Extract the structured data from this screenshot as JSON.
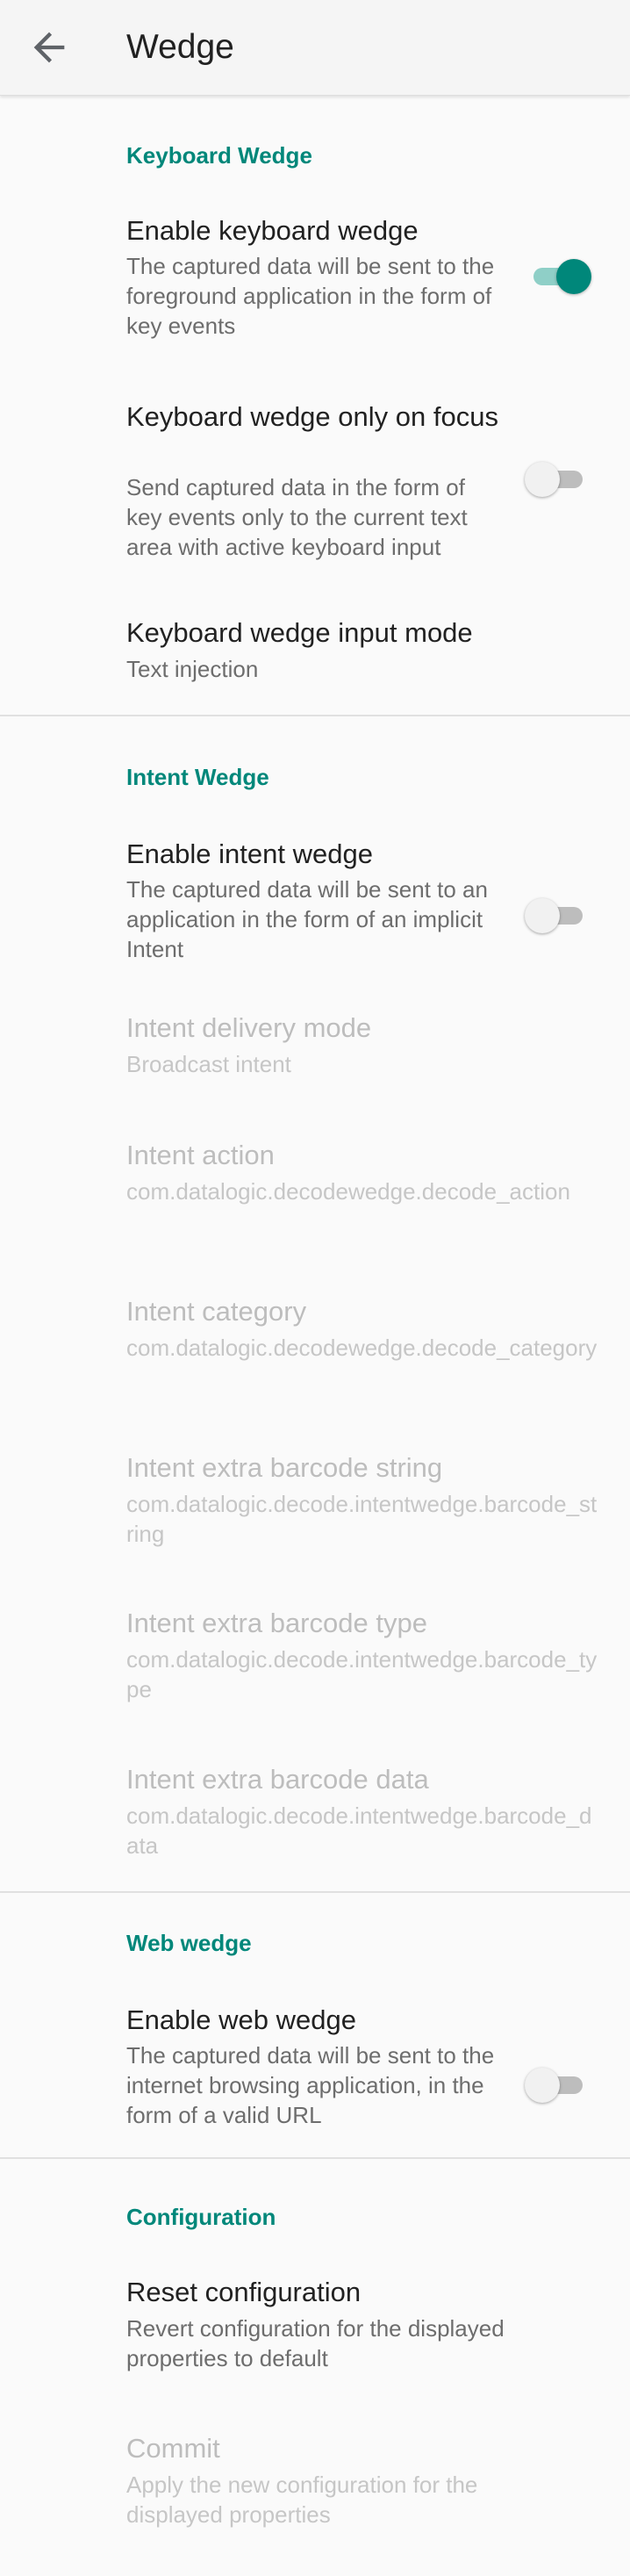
{
  "toolbar": {
    "title": "Wedge",
    "back_icon": "arrow-back-icon"
  },
  "keyboard_wedge": {
    "section_title": "Keyboard Wedge",
    "enable": {
      "title": "Enable keyboard wedge",
      "summary": "The captured data will be sent to the foreground application in the form of key events",
      "checked": true
    },
    "only_on_focus": {
      "title": "Keyboard wedge only on focus",
      "summary": "Send captured data in the form of key events only to the current text area with active keyboard input",
      "checked": false
    },
    "input_mode": {
      "title": "Keyboard wedge input mode",
      "summary": "Text injection"
    }
  },
  "intent_wedge": {
    "section_title": "Intent Wedge",
    "enable": {
      "title": "Enable intent wedge",
      "summary": "The captured data will be sent to an application in the form of an implicit Intent",
      "checked": false
    },
    "delivery_mode": {
      "title": "Intent delivery mode",
      "summary": "Broadcast intent"
    },
    "action": {
      "title": "Intent action",
      "summary": "com.datalogic.decodewedge.decode_action"
    },
    "category": {
      "title": "Intent category",
      "summary": "com.datalogic.decodewedge.decode_category"
    },
    "extra_string": {
      "title": "Intent extra barcode string",
      "summary": "com.datalogic.decode.intentwedge.barcode_string"
    },
    "extra_type": {
      "title": "Intent extra barcode type",
      "summary": "com.datalogic.decode.intentwedge.barcode_type"
    },
    "extra_data": {
      "title": "Intent extra barcode data",
      "summary": "com.datalogic.decode.intentwedge.barcode_data"
    }
  },
  "web_wedge": {
    "section_title": "Web wedge",
    "enable": {
      "title": "Enable web wedge",
      "summary": "The captured data will be sent to the internet browsing application, in the form of a valid URL",
      "checked": false
    }
  },
  "configuration": {
    "section_title": "Configuration",
    "reset": {
      "title": "Reset configuration",
      "summary": "Revert configuration for the displayed properties to default"
    },
    "commit": {
      "title": "Commit",
      "summary": "Apply the new configuration for the displayed properties"
    }
  },
  "colors": {
    "accent": "#00877a",
    "text_primary": "#212121",
    "text_secondary": "#6d6d6d",
    "text_disabled": "#bdbdbd"
  }
}
